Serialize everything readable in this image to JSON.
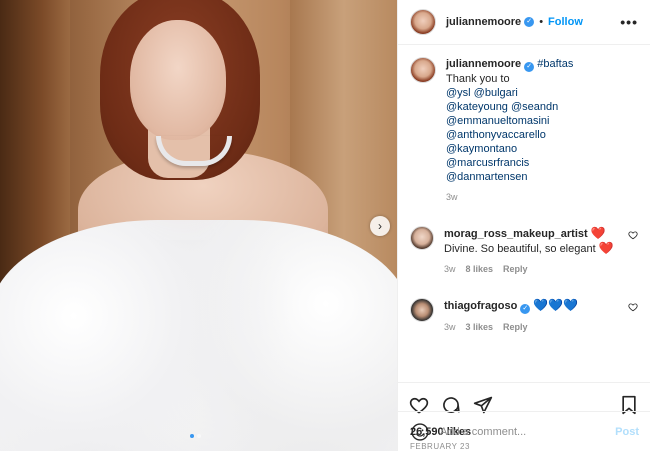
{
  "post": {
    "author": "juliannemoore",
    "follow_label": "Follow",
    "bullet": "•",
    "more_label": "•••",
    "next_arrow": "›",
    "carousel": {
      "count": 2,
      "active_index": 0
    }
  },
  "caption": {
    "username": "juliannemoore",
    "hashtag": "#baftas",
    "lines": [
      "Thank you to",
      "@ysl @bulgari",
      "@kateyoung @seandn",
      "@emmanueltomasini",
      "@anthonyvaccarello",
      "@kaymontano",
      "@marcusrfrancis",
      "@danmartensen"
    ],
    "age": "3w"
  },
  "comments": [
    {
      "username": "morag_ross_makeup_artist",
      "suffix": "❤️",
      "text": "Divine. So beautiful, so elegant",
      "text_suffix": "❤️",
      "age": "3w",
      "likes": "8 likes",
      "reply_label": "Reply"
    },
    {
      "username": "thiagofragoso",
      "suffix": "💙💙💙",
      "age": "3w",
      "likes": "3 likes",
      "reply_label": "Reply"
    }
  ],
  "stats": {
    "likes": "26,590 likes",
    "date": "FEBRUARY 23"
  },
  "add_comment": {
    "placeholder": "Add a comment...",
    "post_label": "Post"
  },
  "colors": {
    "accent": "#0095f6",
    "verified": "#3897f0",
    "mention": "#00376b",
    "muted": "#8e8e8e",
    "heart": "#ed4956"
  },
  "icons": {
    "header": [
      "avatar",
      "verified-badge-icon",
      "more-options-icon"
    ],
    "actions": [
      "heart-icon",
      "comment-icon",
      "share-icon",
      "bookmark-icon"
    ],
    "composer": [
      "emoji-icon"
    ]
  }
}
